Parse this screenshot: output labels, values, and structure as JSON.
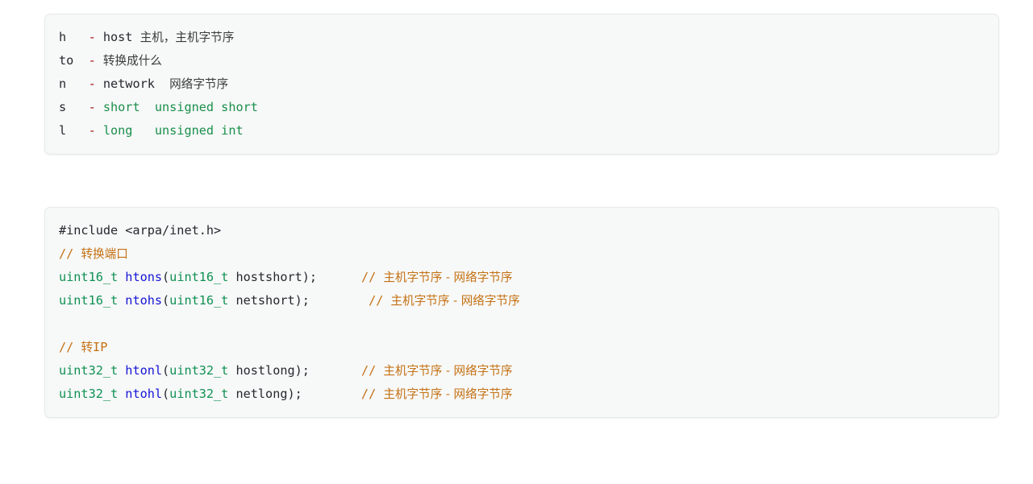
{
  "document": {
    "kind": "code-notes",
    "background_color": "#ffffff",
    "card_background": "#f7f8f8",
    "card_border_color": "#e6e9ec"
  },
  "palette": {
    "plain": "#24292e",
    "dash": "#a31515",
    "keyword_green": "#1a8f4a",
    "type_green": "#0f9152",
    "function_blue": "#1515d6",
    "comment_orange": "#c47113",
    "cjk_text": "#3b3b3b"
  },
  "blocks": [
    {
      "id": "legend",
      "name": "mnemonic-legend-block",
      "lines": [
        {
          "id": "legend-h",
          "segments": [
            {
              "text": "h   ",
              "style": "plain"
            },
            {
              "text": "- ",
              "style": "dash"
            },
            {
              "text": "host ",
              "style": "plain"
            },
            {
              "text": "主机，主机字节序",
              "style": "cjk"
            }
          ]
        },
        {
          "id": "legend-to",
          "segments": [
            {
              "text": "to  ",
              "style": "plain"
            },
            {
              "text": "- ",
              "style": "dash"
            },
            {
              "text": "转换成什么",
              "style": "cjk"
            }
          ]
        },
        {
          "id": "legend-n",
          "segments": [
            {
              "text": "n   ",
              "style": "plain"
            },
            {
              "text": "- ",
              "style": "dash"
            },
            {
              "text": "network  ",
              "style": "plain"
            },
            {
              "text": "网络字节序",
              "style": "cjk"
            }
          ]
        },
        {
          "id": "legend-s",
          "segments": [
            {
              "text": "s   ",
              "style": "plain"
            },
            {
              "text": "- ",
              "style": "dash"
            },
            {
              "text": "short  unsigned short",
              "style": "green"
            }
          ]
        },
        {
          "id": "legend-l",
          "segments": [
            {
              "text": "l   ",
              "style": "plain"
            },
            {
              "text": "- ",
              "style": "dash"
            },
            {
              "text": "long   unsigned int",
              "style": "green"
            }
          ]
        }
      ]
    },
    {
      "id": "api",
      "name": "byte-order-api-block",
      "lines": [
        {
          "id": "api-include",
          "segments": [
            {
              "text": "#include <arpa/inet.h>",
              "style": "plain"
            }
          ]
        },
        {
          "id": "api-comment-port",
          "segments": [
            {
              "text": "// ",
              "style": "comment"
            },
            {
              "text": "转换端口",
              "style": "comment-cjk"
            }
          ]
        },
        {
          "id": "api-htons",
          "segments": [
            {
              "text": "uint16_t ",
              "style": "type"
            },
            {
              "text": "htons",
              "style": "fn"
            },
            {
              "text": "(",
              "style": "punc"
            },
            {
              "text": "uint16_t",
              "style": "type"
            },
            {
              "text": " hostshort);",
              "style": "plain"
            },
            {
              "text": "      ",
              "style": "plain"
            },
            {
              "text": "// ",
              "style": "comment"
            },
            {
              "text": "主机字节序 - 网络字节序",
              "style": "comment-cjk"
            }
          ]
        },
        {
          "id": "api-ntohs",
          "segments": [
            {
              "text": "uint16_t ",
              "style": "type"
            },
            {
              "text": "ntohs",
              "style": "fn"
            },
            {
              "text": "(",
              "style": "punc"
            },
            {
              "text": "uint16_t",
              "style": "type"
            },
            {
              "text": " netshort);",
              "style": "plain"
            },
            {
              "text": "        ",
              "style": "plain"
            },
            {
              "text": "// ",
              "style": "comment"
            },
            {
              "text": "主机字节序 - 网络字节序",
              "style": "comment-cjk"
            }
          ]
        },
        {
          "id": "api-blank-1",
          "segments": []
        },
        {
          "id": "api-comment-ip",
          "segments": [
            {
              "text": "// ",
              "style": "comment"
            },
            {
              "text": "转",
              "style": "comment-cjk"
            },
            {
              "text": "IP",
              "style": "comment"
            }
          ]
        },
        {
          "id": "api-htonl",
          "segments": [
            {
              "text": "uint32_t ",
              "style": "type"
            },
            {
              "text": "htonl",
              "style": "fn"
            },
            {
              "text": "(",
              "style": "punc"
            },
            {
              "text": "uint32_t",
              "style": "type"
            },
            {
              "text": " hostlong);",
              "style": "plain"
            },
            {
              "text": "       ",
              "style": "plain"
            },
            {
              "text": "// ",
              "style": "comment"
            },
            {
              "text": "主机字节序 - 网络字节序",
              "style": "comment-cjk"
            }
          ]
        },
        {
          "id": "api-ntohl",
          "segments": [
            {
              "text": "uint32_t ",
              "style": "type"
            },
            {
              "text": "ntohl",
              "style": "fn"
            },
            {
              "text": "(",
              "style": "punc"
            },
            {
              "text": "uint32_t",
              "style": "type"
            },
            {
              "text": " netlong);",
              "style": "plain"
            },
            {
              "text": "        ",
              "style": "plain"
            },
            {
              "text": "// ",
              "style": "comment"
            },
            {
              "text": "主机字节序 - 网络字节序",
              "style": "comment-cjk"
            }
          ]
        }
      ]
    }
  ]
}
